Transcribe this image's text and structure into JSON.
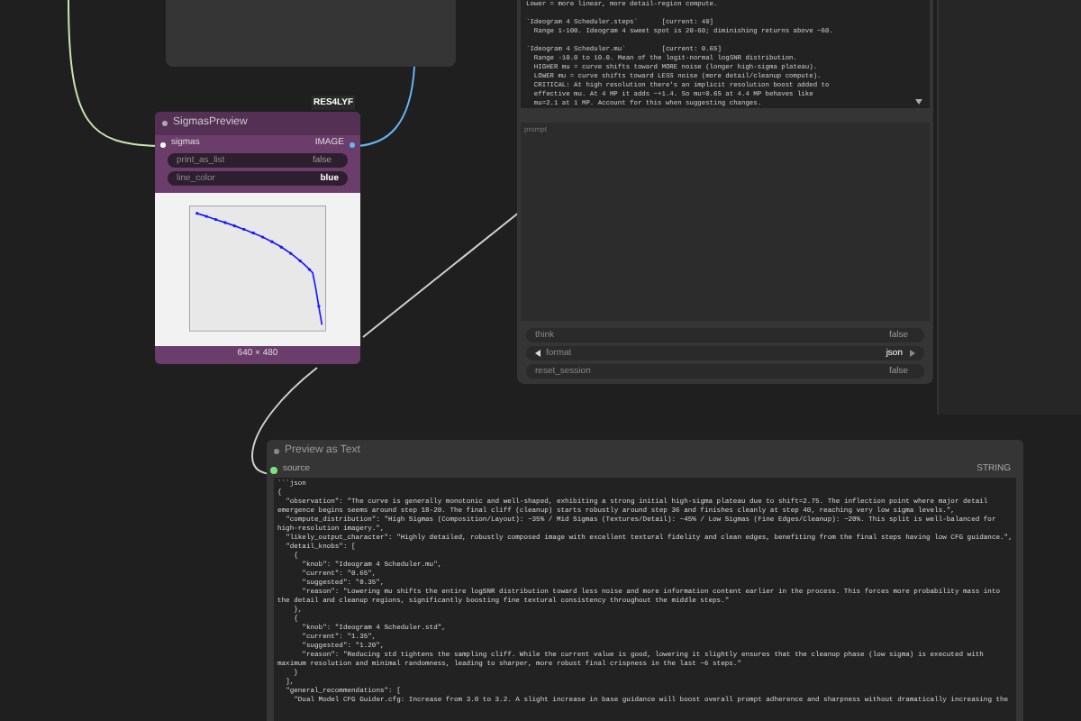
{
  "sigmas_preview": {
    "title": "SigmasPreview",
    "badge": "RES4LYF",
    "input": "sigmas",
    "output": "IMAGE",
    "widgets": [
      {
        "label": "print_as_list",
        "value": "false",
        "kind": "toggle"
      },
      {
        "label": "line_color",
        "value": "blue",
        "kind": "text"
      }
    ],
    "image_size": "640 × 480"
  },
  "llm_node": {
    "paragraphs": [
      {
        "lines": [
          "Lower = more linear, more detail-region compute."
        ]
      },
      {
        "lines": [
          "`Ideogram 4 Scheduler.steps`      [current: 40]",
          "  Range 1-100. Ideogram 4 sweet spot is 20-60; diminishing returns above ~60."
        ]
      },
      {
        "lines": [
          "`Ideogram 4 Scheduler.mu`         [current: 0.65]",
          "  Range -10.0 to 10.0. Mean of the logit-normal logSNR distribution.",
          "  HIGHER mu = curve shifts toward MORE noise (longer high-sigma plateau).",
          "  LOWER mu = curve shifts toward LESS noise (more detail/cleanup compute).",
          "  CRITICAL: At high resolution there's an implicit resolution boost added to",
          "  effective mu. At 4 MP it adds ~+1.4. So mu=0.65 at 4.4 MP behaves like",
          "  mu=2.1 at 1 MP. Account for this when suggesting changes."
        ]
      }
    ],
    "prompt_placeholder": "prompt",
    "widgets": [
      {
        "kind": "toggle",
        "label": "think",
        "value": "false"
      },
      {
        "kind": "combo",
        "label": "format",
        "value": "json"
      },
      {
        "kind": "toggle",
        "label": "reset_session",
        "value": "false"
      }
    ]
  },
  "preview_text": {
    "title": "Preview as Text",
    "input": "source",
    "input_type": "STRING",
    "lines": [
      "```json",
      "{",
      "  \"observation\": \"The curve is generally monotonic and well-shaped, exhibiting a strong initial high-sigma plateau due to shift=2.75. The inflection point where major detail emergence begins seems around step 18-20. The final cliff (cleanup) starts robustly around step 36 and finishes cleanly at step 40, reaching very low sigma levels.\",",
      "  \"compute_distribution\": \"High Sigmas (Composition/Layout): ~35% / Mid Sigmas (Textures/Detail): ~45% / Low Sigmas (Fine Edges/Cleanup): ~20%. This split is well-balanced for high-resolution imagery.\",",
      "  \"likely_output_character\": \"Highly detailed, robustly composed image with excellent textural fidelity and clean edges, benefiting from the final steps having low CFG guidance.\",",
      "  \"detail_knobs\": [",
      "    {",
      "      \"knob\": \"Ideogram 4 Scheduler.mu\",",
      "      \"current\": \"0.65\",",
      "      \"suggested\": \"0.35\",",
      "      \"reason\": \"Lowering mu shifts the entire logSNR distribution toward less noise and more information content earlier in the process. This forces more probability mass into the detail and cleanup regions, significantly boosting fine textural consistency throughout the middle steps.\"",
      "    },",
      "    {",
      "      \"knob\": \"Ideogram 4 Scheduler.std\",",
      "      \"current\": \"1.35\",",
      "      \"suggested\": \"1.20\",",
      "      \"reason\": \"Reducing std tightens the sampling cliff. While the current value is good, lowering it slightly ensures that the cleanup phase (low sigma) is executed with maximum resolution and minimal randomness, leading to sharper, more robust final crispness in the last ~6 steps.\"",
      "    }",
      "  ],",
      "  \"general_recommendations\": [",
      "    \"Dual Model CFG Guider.cfg: Increase from 3.0 to 3.2. A slight increase in base guidance will boost overall prompt adherence and sharpness without dramatically increasing the"
    ]
  }
}
